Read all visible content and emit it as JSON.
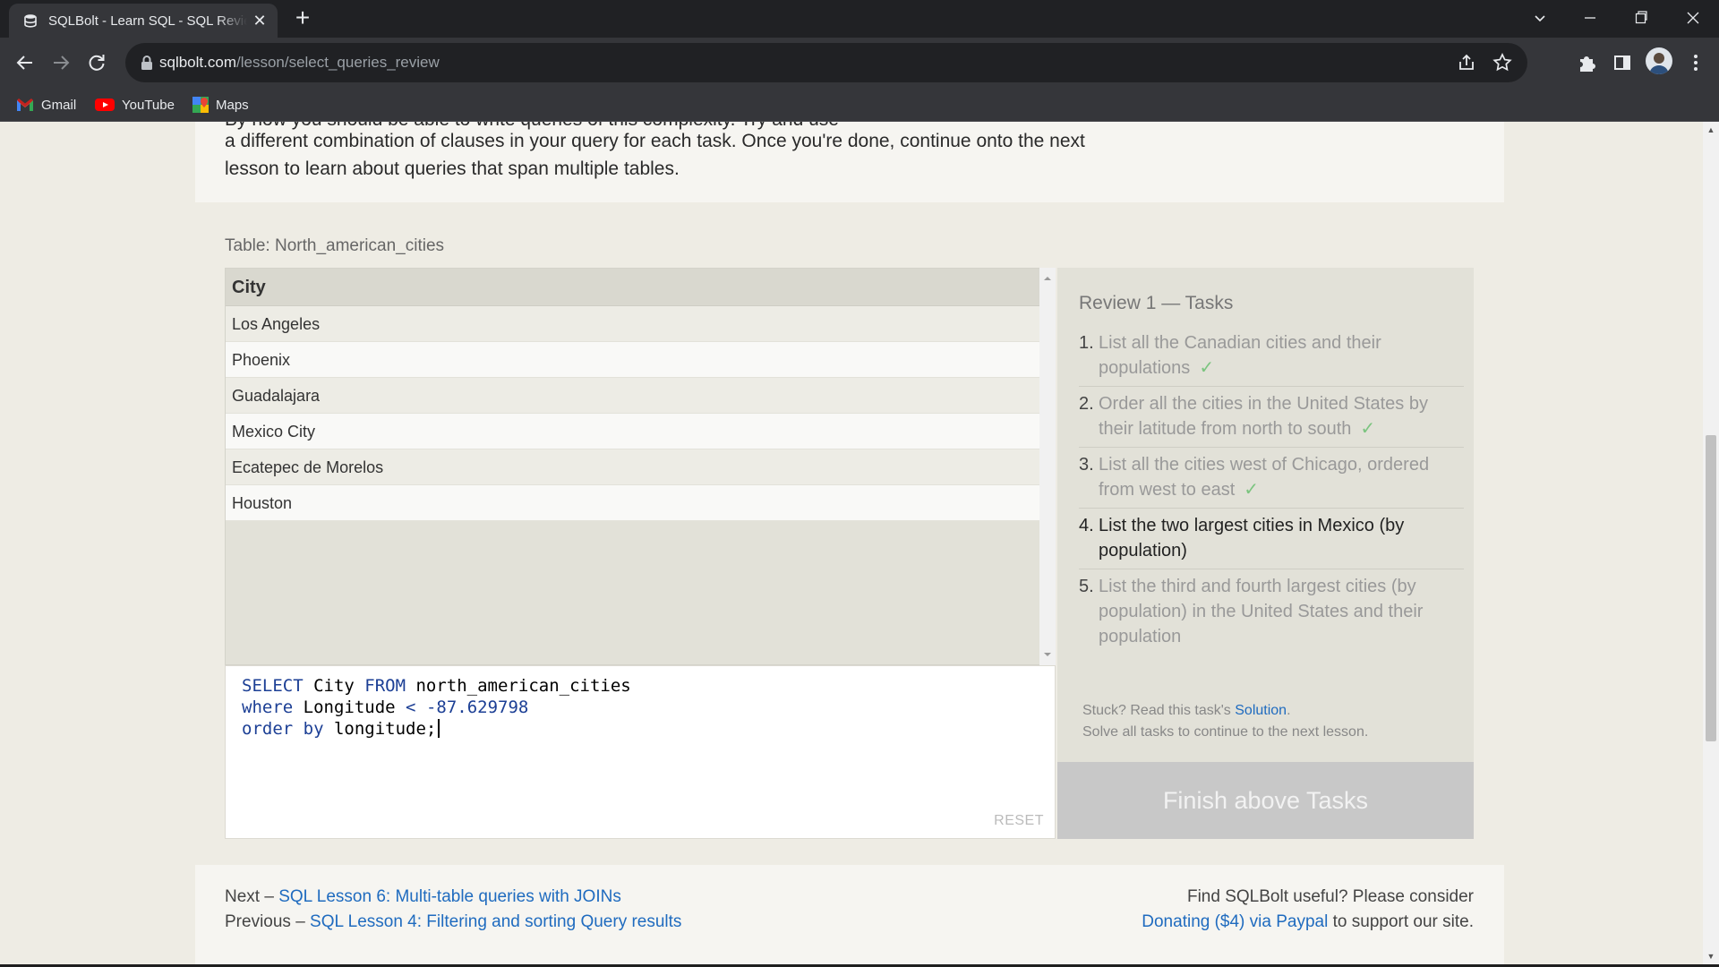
{
  "browser": {
    "tab_title": "SQLBolt - Learn SQL - SQL Review: Simple SELECT Queries",
    "url_host": "sqlbolt.com",
    "url_path": "/lesson/select_queries_review",
    "bookmarks": [
      {
        "label": "Gmail",
        "icon": "gmail-icon"
      },
      {
        "label": "YouTube",
        "icon": "youtube-icon"
      },
      {
        "label": "Maps",
        "icon": "maps-icon"
      }
    ]
  },
  "intro": {
    "line_cut": "By now you should be able to write queries of this complexity. Try and use",
    "line2": "a different combination of clauses in your query for each task. Once you're done, continue onto the next",
    "line3": "lesson to learn about queries that span multiple tables."
  },
  "table": {
    "label": "Table: North_american_cities",
    "header": "City",
    "rows": [
      "Los Angeles",
      "Phoenix",
      "Guadalajara",
      "Mexico City",
      "Ecatepec de Morelos",
      "Houston"
    ]
  },
  "editor": {
    "line1": {
      "kw1": "SELECT",
      "t1": " City ",
      "kw2": "FROM",
      "t2": " north_american_cities"
    },
    "line2": {
      "kw1": "where",
      "t1": " Longitude ",
      "op": "<",
      "t2": " ",
      "num": "-87.629798"
    },
    "line3": {
      "kw1": "order",
      "t1": " ",
      "kw2": "by",
      "t2": " longitude;"
    },
    "reset_label": "RESET"
  },
  "tasks": {
    "title": "Review 1 — Tasks",
    "check": "✓",
    "items": [
      {
        "num": "1.",
        "text": "List all the Canadian cities and their populations",
        "done": true
      },
      {
        "num": "2.",
        "text": "Order all the cities in the United States by their latitude from north to south",
        "done": true
      },
      {
        "num": "3.",
        "text": "List all the cities west of Chicago, ordered from west to east",
        "done": true
      },
      {
        "num": "4.",
        "text": "List the two largest cities in Mexico (by population)",
        "done": false
      },
      {
        "num": "5.",
        "text": "List the third and fourth largest cities (by population) in the United States and their population",
        "done": false
      }
    ],
    "stuck_prefix": "Stuck? Read this task's ",
    "stuck_link": "Solution",
    "stuck_suffix": ".",
    "stuck_line2": "Solve all tasks to continue to the next lesson.",
    "finish_label": "Finish above Tasks"
  },
  "footer": {
    "next_prefix": "Next – ",
    "next_link": "SQL Lesson 6: Multi-table queries with JOINs",
    "prev_prefix": "Previous – ",
    "prev_link": "SQL Lesson 4: Filtering and sorting Query results",
    "support_line1": "Find SQLBolt useful? Please consider",
    "donate_link": "Donating ($4) via Paypal",
    "support_suffix": " to support our site."
  }
}
